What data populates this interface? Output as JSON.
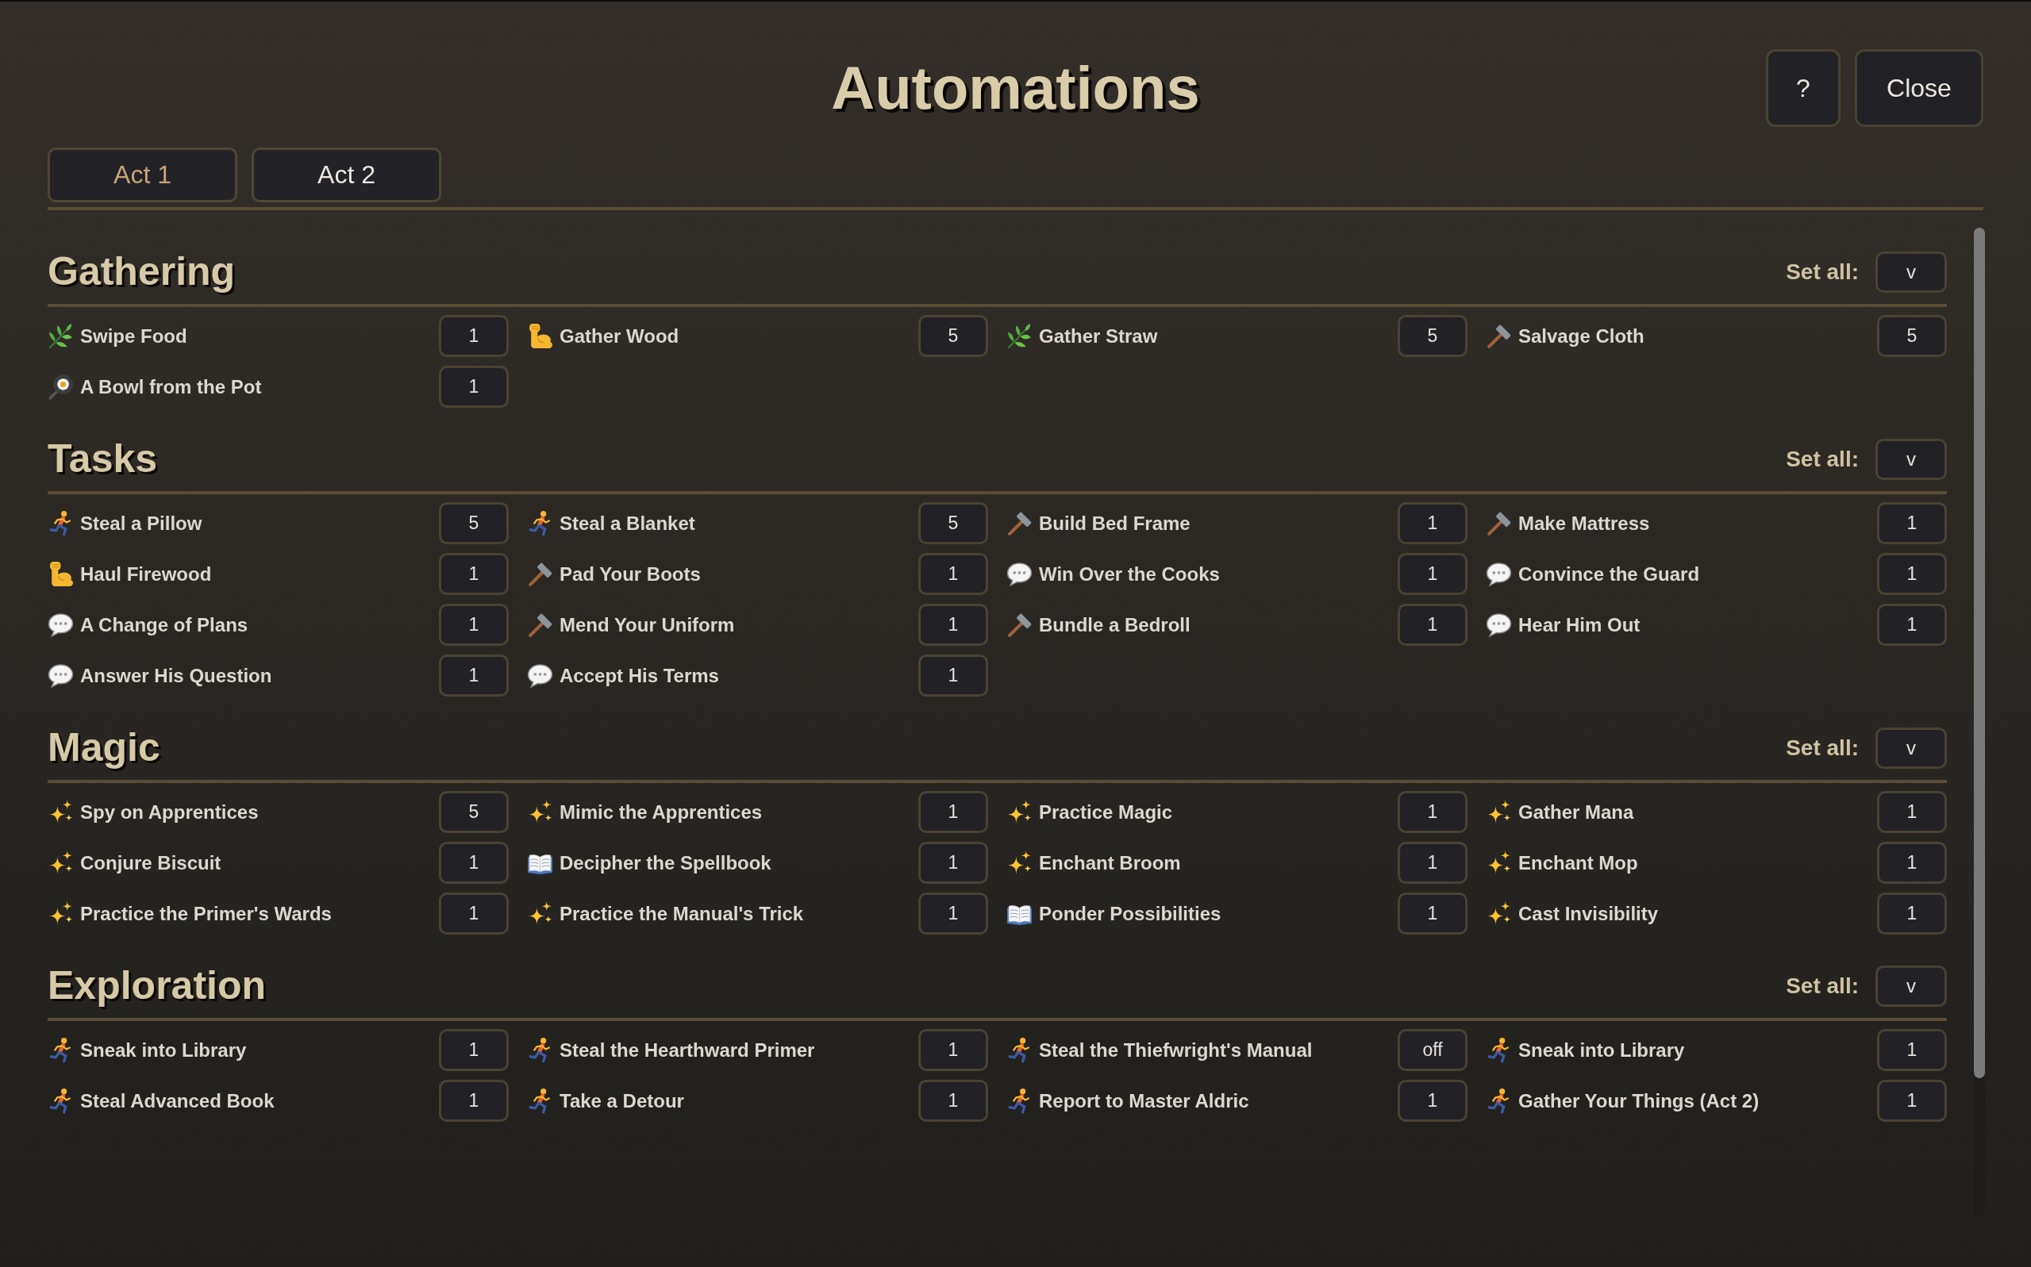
{
  "window": {
    "title": "Automations"
  },
  "help_button": {
    "label": "?"
  },
  "close_button": {
    "label": "Close"
  },
  "tabs": [
    {
      "label": "Act 1",
      "selected": true
    },
    {
      "label": "Act 2",
      "selected": false
    }
  ],
  "sections": [
    {
      "title": "Gathering",
      "set_all": {
        "label": "Set all:",
        "value": "v"
      },
      "items": [
        {
          "kind": "herb",
          "name": "Swipe Food",
          "value": "1"
        },
        {
          "kind": "muscle",
          "name": "Gather Wood",
          "value": "5"
        },
        {
          "kind": "herb",
          "name": "Gather Straw",
          "value": "5"
        },
        {
          "kind": "hammer",
          "name": "Salvage Cloth",
          "value": "5"
        },
        {
          "kind": "pan",
          "name": "A Bowl from the Pot",
          "value": "1"
        }
      ]
    },
    {
      "title": "Tasks",
      "set_all": {
        "label": "Set all:",
        "value": "v"
      },
      "items": [
        {
          "kind": "runner",
          "name": "Steal a Pillow",
          "value": "5"
        },
        {
          "kind": "runner",
          "name": "Steal a Blanket",
          "value": "5"
        },
        {
          "kind": "hammer",
          "name": "Build Bed Frame",
          "value": "1"
        },
        {
          "kind": "hammer",
          "name": "Make Mattress",
          "value": "1"
        },
        {
          "kind": "muscle",
          "name": "Haul Firewood",
          "value": "1"
        },
        {
          "kind": "hammer",
          "name": "Pad Your Boots",
          "value": "1"
        },
        {
          "kind": "speech",
          "name": "Win Over the Cooks",
          "value": "1"
        },
        {
          "kind": "speech",
          "name": "Convince the Guard",
          "value": "1"
        },
        {
          "kind": "speech",
          "name": "A Change of Plans",
          "value": "1"
        },
        {
          "kind": "hammer",
          "name": "Mend Your Uniform",
          "value": "1"
        },
        {
          "kind": "hammer",
          "name": "Bundle a Bedroll",
          "value": "1"
        },
        {
          "kind": "speech",
          "name": "Hear Him Out",
          "value": "1"
        },
        {
          "kind": "speech",
          "name": "Answer His Question",
          "value": "1"
        },
        {
          "kind": "speech",
          "name": "Accept His Terms",
          "value": "1"
        }
      ]
    },
    {
      "title": "Magic",
      "set_all": {
        "label": "Set all:",
        "value": "v"
      },
      "items": [
        {
          "kind": "sparkle",
          "name": "Spy on Apprentices",
          "value": "5"
        },
        {
          "kind": "sparkle",
          "name": "Mimic the Apprentices",
          "value": "1"
        },
        {
          "kind": "sparkle",
          "name": "Practice Magic",
          "value": "1"
        },
        {
          "kind": "sparkle",
          "name": "Gather Mana",
          "value": "1"
        },
        {
          "kind": "sparkle",
          "name": "Conjure Biscuit",
          "value": "1"
        },
        {
          "kind": "book",
          "name": "Decipher the Spellbook",
          "value": "1"
        },
        {
          "kind": "sparkle",
          "name": "Enchant Broom",
          "value": "1"
        },
        {
          "kind": "sparkle",
          "name": "Enchant Mop",
          "value": "1"
        },
        {
          "kind": "sparkle",
          "name": "Practice the Primer's Wards",
          "value": "1"
        },
        {
          "kind": "sparkle",
          "name": "Practice the Manual's Trick",
          "value": "1"
        },
        {
          "kind": "book",
          "name": "Ponder Possibilities",
          "value": "1"
        },
        {
          "kind": "sparkle",
          "name": "Cast Invisibility",
          "value": "1"
        }
      ]
    },
    {
      "title": "Exploration",
      "set_all": {
        "label": "Set all:",
        "value": "v"
      },
      "items": [
        {
          "kind": "runner",
          "name": "Sneak into Library",
          "value": "1"
        },
        {
          "kind": "runner",
          "name": "Steal the Hearthward Primer",
          "value": "1"
        },
        {
          "kind": "runner",
          "name": "Steal the Thiefwright's Manual",
          "value": "off"
        },
        {
          "kind": "runner",
          "name": "Sneak into Library",
          "value": "1"
        },
        {
          "kind": "runner",
          "name": "Steal Advanced Book",
          "value": "1"
        },
        {
          "kind": "runner",
          "name": "Take a Detour",
          "value": "1"
        },
        {
          "kind": "runner",
          "name": "Report to Master Aldric",
          "value": "1"
        },
        {
          "kind": "runner",
          "name": "Gather Your Things (Act 2)",
          "value": "1"
        }
      ]
    }
  ]
}
